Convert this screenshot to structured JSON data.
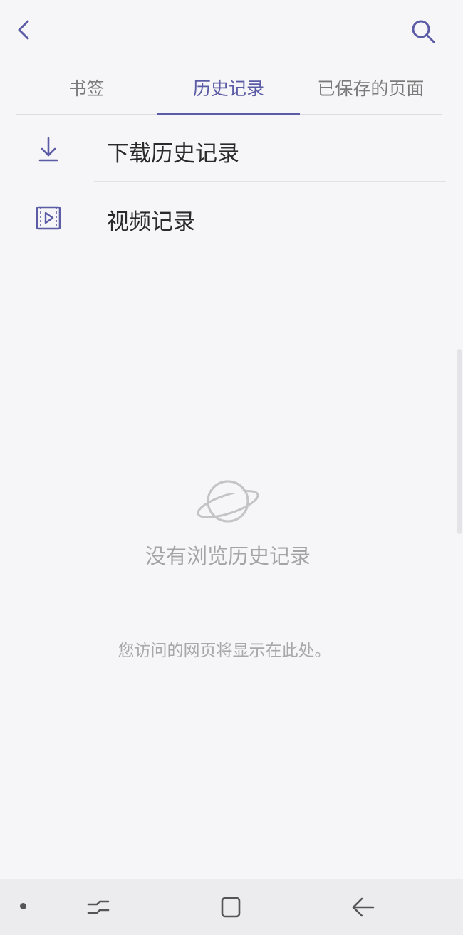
{
  "header": {
    "back_icon": "chevron-left-icon",
    "search_icon": "search-icon"
  },
  "tabs": [
    {
      "label": "书签",
      "active": false
    },
    {
      "label": "历史记录",
      "active": true
    },
    {
      "label": "已保存的页面",
      "active": false
    }
  ],
  "list": [
    {
      "label": "下载历史记录",
      "icon": "download-icon"
    },
    {
      "label": "视频记录",
      "icon": "video-icon"
    }
  ],
  "empty_state": {
    "icon": "planet-icon",
    "title": "没有浏览历史记录",
    "subtitle": "您访问的网页将显示在此处。"
  },
  "colors": {
    "accent": "#5b5ba6",
    "background": "#f6f6f8",
    "muted_text": "#a4a4a8"
  },
  "nav_bar": {
    "icons": [
      "dot-icon",
      "recents-icon",
      "home-icon",
      "back-arrow-icon"
    ]
  }
}
